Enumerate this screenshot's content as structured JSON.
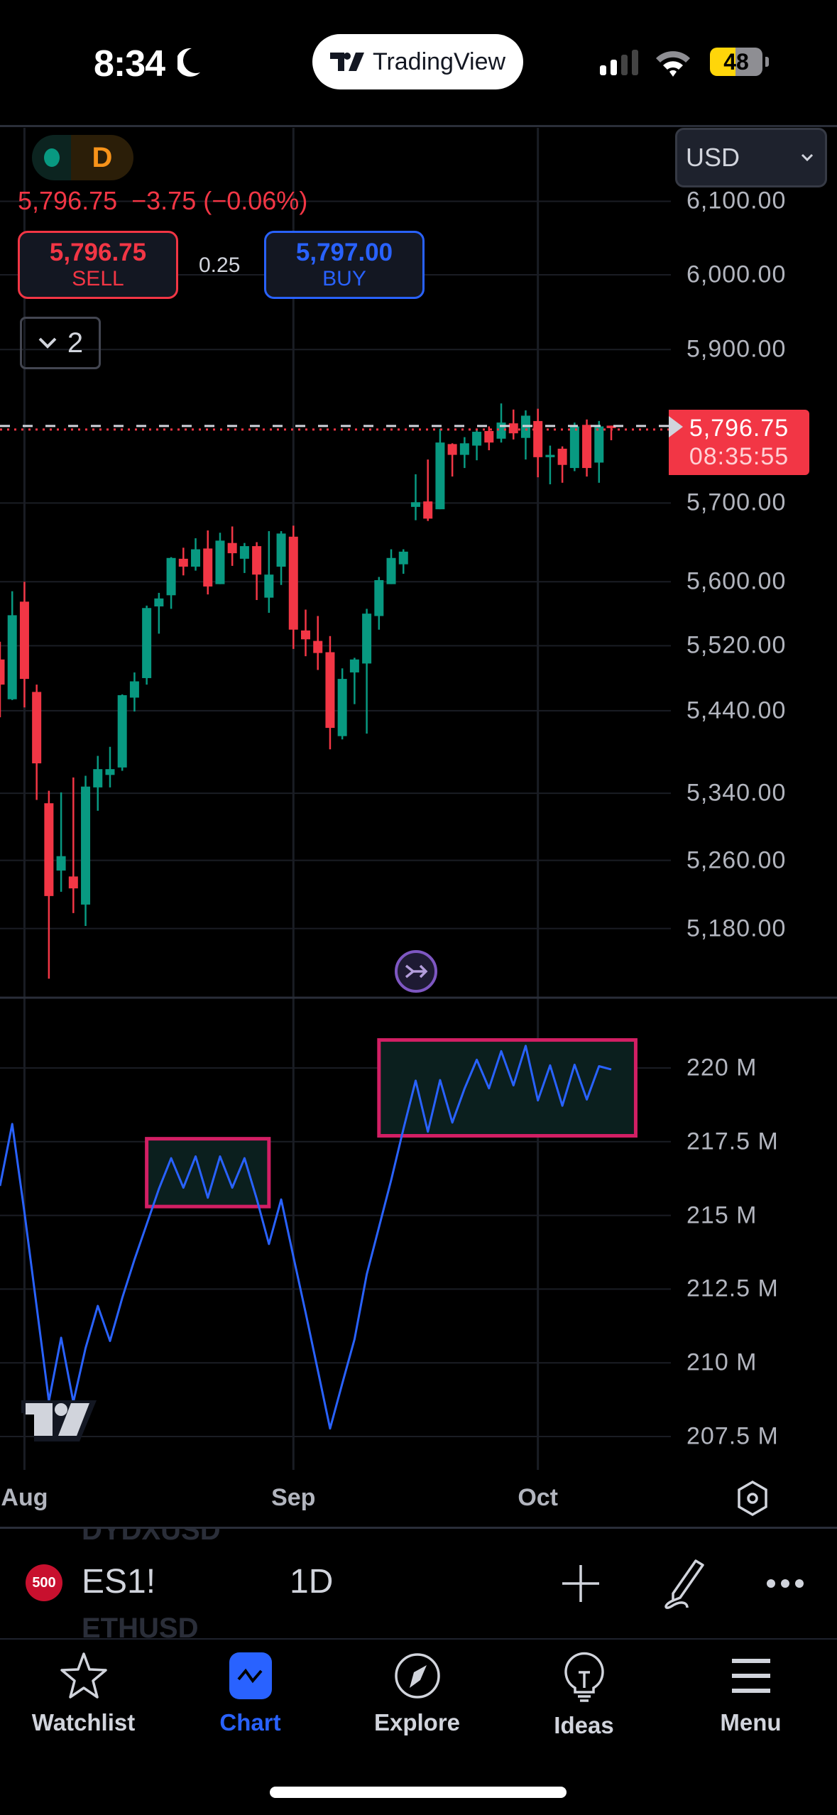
{
  "status_bar": {
    "time": "8:34",
    "app_pill": "TradingView",
    "battery": "48",
    "icons": [
      "moon-icon",
      "signal-icon",
      "wifi-icon",
      "battery-icon"
    ]
  },
  "chart_header": {
    "status_dot_color": "#089981",
    "session_badge": "D",
    "price_change": "5,796.75  −3.75 (−0.06%)",
    "sell": {
      "price": "5,796.75",
      "label": "SELL"
    },
    "spread": "0.25",
    "buy": {
      "price": "5,797.00",
      "label": "BUY"
    },
    "indicators_toggle": "2",
    "currency": "USD"
  },
  "colors": {
    "up": "#089981",
    "down": "#f23645",
    "indicator_line": "#2962ff",
    "box_border": "#d21f64",
    "box_fill": "#0b1f1e",
    "accent": "#2962ff"
  },
  "chart_data": [
    {
      "type": "candlestick",
      "symbol": "ES1!",
      "interval": "1D",
      "scale": "log",
      "ylim": [
        5100,
        6120
      ],
      "grid": true,
      "y_tick_labels": [
        "6,100.00",
        "6,000.00",
        "5,900.00",
        "5,700.00",
        "5,600.00",
        "5,520.00",
        "5,440.00",
        "5,340.00",
        "5,260.00",
        "5,180.00"
      ],
      "x_tick_labels": [
        {
          "label": "Aug",
          "date": "Aug 1"
        },
        {
          "label": "Sep",
          "date": "Sep 3"
        },
        {
          "label": "Oct",
          "date": "Oct 1"
        }
      ],
      "last_price": {
        "value": 5796.75,
        "label": "5,796.75",
        "countdown": "08:35:55"
      },
      "candles": [
        {
          "t": "Jul 30",
          "o": 5503,
          "h": 5525,
          "l": 5432,
          "c": 5472
        },
        {
          "t": "Jul 31",
          "o": 5454,
          "h": 5588,
          "l": 5453,
          "c": 5558
        },
        {
          "t": "Aug 1",
          "o": 5575,
          "h": 5600,
          "l": 5444,
          "c": 5479
        },
        {
          "t": "Aug 2",
          "o": 5463,
          "h": 5472,
          "l": 5332,
          "c": 5376
        },
        {
          "t": "Aug 5",
          "o": 5328,
          "h": 5343,
          "l": 5122,
          "c": 5218
        },
        {
          "t": "Aug 6",
          "o": 5248,
          "h": 5341,
          "l": 5223,
          "c": 5265
        },
        {
          "t": "Aug 7",
          "o": 5241,
          "h": 5359,
          "l": 5198,
          "c": 5227
        },
        {
          "t": "Aug 8",
          "o": 5208,
          "h": 5361,
          "l": 5183,
          "c": 5348
        },
        {
          "t": "Aug 9",
          "o": 5347,
          "h": 5385,
          "l": 5319,
          "c": 5369
        },
        {
          "t": "Aug 12",
          "o": 5362,
          "h": 5396,
          "l": 5347,
          "c": 5369
        },
        {
          "t": "Aug 13",
          "o": 5371,
          "h": 5460,
          "l": 5367,
          "c": 5459
        },
        {
          "t": "Aug 14",
          "o": 5456,
          "h": 5487,
          "l": 5439,
          "c": 5476
        },
        {
          "t": "Aug 15",
          "o": 5480,
          "h": 5570,
          "l": 5472,
          "c": 5567
        },
        {
          "t": "Aug 16",
          "o": 5569,
          "h": 5586,
          "l": 5535,
          "c": 5579
        },
        {
          "t": "Aug 19",
          "o": 5583,
          "h": 5631,
          "l": 5566,
          "c": 5630
        },
        {
          "t": "Aug 20",
          "o": 5629,
          "h": 5643,
          "l": 5608,
          "c": 5619
        },
        {
          "t": "Aug 21",
          "o": 5619,
          "h": 5655,
          "l": 5614,
          "c": 5641
        },
        {
          "t": "Aug 22",
          "o": 5642,
          "h": 5665,
          "l": 5584,
          "c": 5594
        },
        {
          "t": "Aug 23",
          "o": 5597,
          "h": 5662,
          "l": 5597,
          "c": 5652
        },
        {
          "t": "Aug 26",
          "o": 5649,
          "h": 5670,
          "l": 5620,
          "c": 5636
        },
        {
          "t": "Aug 27",
          "o": 5629,
          "h": 5649,
          "l": 5611,
          "c": 5645
        },
        {
          "t": "Aug 28",
          "o": 5645,
          "h": 5650,
          "l": 5577,
          "c": 5609
        },
        {
          "t": "Aug 29",
          "o": 5580,
          "h": 5664,
          "l": 5561,
          "c": 5609
        },
        {
          "t": "Aug 30",
          "o": 5619,
          "h": 5664,
          "l": 5596,
          "c": 5661
        },
        {
          "t": "Sep 3",
          "o": 5657,
          "h": 5671,
          "l": 5516,
          "c": 5540
        },
        {
          "t": "Sep 4",
          "o": 5539,
          "h": 5565,
          "l": 5507,
          "c": 5528
        },
        {
          "t": "Sep 5",
          "o": 5526,
          "h": 5557,
          "l": 5490,
          "c": 5511
        },
        {
          "t": "Sep 6",
          "o": 5512,
          "h": 5532,
          "l": 5393,
          "c": 5419
        },
        {
          "t": "Sep 9",
          "o": 5409,
          "h": 5492,
          "l": 5405,
          "c": 5479
        },
        {
          "t": "Sep 10",
          "o": 5487,
          "h": 5505,
          "l": 5448,
          "c": 5503
        },
        {
          "t": "Sep 11",
          "o": 5498,
          "h": 5566,
          "l": 5412,
          "c": 5560
        },
        {
          "t": "Sep 12",
          "o": 5557,
          "h": 5606,
          "l": 5540,
          "c": 5602
        },
        {
          "t": "Sep 13",
          "o": 5597,
          "h": 5641,
          "l": 5597,
          "c": 5630
        },
        {
          "t": "Sep 16",
          "o": 5622,
          "h": 5641,
          "l": 5610,
          "c": 5638
        },
        {
          "t": "Sep 17",
          "o": 5695,
          "h": 5737,
          "l": 5678,
          "c": 5701
        },
        {
          "t": "Sep 18",
          "o": 5702,
          "h": 5756,
          "l": 5677,
          "c": 5680
        },
        {
          "t": "Sep 19",
          "o": 5692,
          "h": 5796,
          "l": 5692,
          "c": 5778
        },
        {
          "t": "Sep 20",
          "o": 5776,
          "h": 5777,
          "l": 5734,
          "c": 5762
        },
        {
          "t": "Sep 23",
          "o": 5762,
          "h": 5785,
          "l": 5745,
          "c": 5777
        },
        {
          "t": "Sep 24",
          "o": 5774,
          "h": 5795,
          "l": 5755,
          "c": 5792
        },
        {
          "t": "Sep 25",
          "o": 5793,
          "h": 5799,
          "l": 5768,
          "c": 5778
        },
        {
          "t": "Sep 26",
          "o": 5783,
          "h": 5829,
          "l": 5778,
          "c": 5804
        },
        {
          "t": "Sep 27",
          "o": 5803,
          "h": 5821,
          "l": 5782,
          "c": 5790
        },
        {
          "t": "Sep 30",
          "o": 5784,
          "h": 5820,
          "l": 5756,
          "c": 5813
        },
        {
          "t": "Oct 1",
          "o": 5806,
          "h": 5822,
          "l": 5733,
          "c": 5759
        },
        {
          "t": "Oct 2",
          "o": 5759,
          "h": 5774,
          "l": 5724,
          "c": 5762
        },
        {
          "t": "Oct 3",
          "o": 5770,
          "h": 5773,
          "l": 5726,
          "c": 5749
        },
        {
          "t": "Oct 4",
          "o": 5745,
          "h": 5804,
          "l": 5741,
          "c": 5799
        },
        {
          "t": "Oct 7",
          "o": 5801,
          "h": 5808,
          "l": 5734,
          "c": 5745
        },
        {
          "t": "Oct 8",
          "o": 5752,
          "h": 5806,
          "l": 5726,
          "c": 5799
        },
        {
          "t": "Oct 9",
          "o": 5800,
          "h": 5800,
          "l": 5781,
          "c": 5796.75
        }
      ]
    },
    {
      "type": "line",
      "ylim": [
        206.5,
        221.5
      ],
      "grid": true,
      "y_tick_labels": [
        "220 M",
        "217.5 M",
        "215 M",
        "212.5 M",
        "210 M",
        "207.5 M"
      ],
      "values_millions": [
        216.0,
        218.1,
        215.1,
        211.9,
        208.7,
        210.85,
        208.67,
        210.5,
        211.93,
        210.74,
        212.2,
        213.5,
        214.7,
        215.9,
        216.94,
        215.94,
        217.0,
        215.6,
        217.0,
        215.94,
        216.94,
        215.56,
        214.03,
        215.54,
        213.6,
        211.7,
        209.74,
        207.77,
        209.3,
        210.8,
        213.0,
        214.6,
        216.2,
        217.93,
        219.57,
        217.84,
        219.59,
        218.15,
        219.3,
        220.28,
        219.31,
        220.57,
        219.41,
        220.75,
        218.9,
        220.09,
        218.72,
        220.11,
        218.93,
        220.06,
        219.95
      ],
      "boxes": [
        {
          "from": "Aug 15",
          "to": "Aug 29",
          "top": 217.6,
          "bottom": 215.3
        },
        {
          "from": "Sep 12",
          "to": "Oct 11",
          "top": 220.95,
          "bottom": 217.7
        }
      ]
    }
  ],
  "symbol_bar": {
    "prev_symbol": "DYDXUSD",
    "symbol_badge": "500",
    "symbol": "ES1!",
    "interval": "1D",
    "next_symbol": "ETHUSD"
  },
  "tab_bar": [
    {
      "label": "Watchlist",
      "icon": "star-icon"
    },
    {
      "label": "Chart",
      "icon": "chart-icon",
      "active": true
    },
    {
      "label": "Explore",
      "icon": "compass-icon"
    },
    {
      "label": "Ideas",
      "icon": "lightbulb-icon"
    },
    {
      "label": "Menu",
      "icon": "menu-icon"
    }
  ]
}
